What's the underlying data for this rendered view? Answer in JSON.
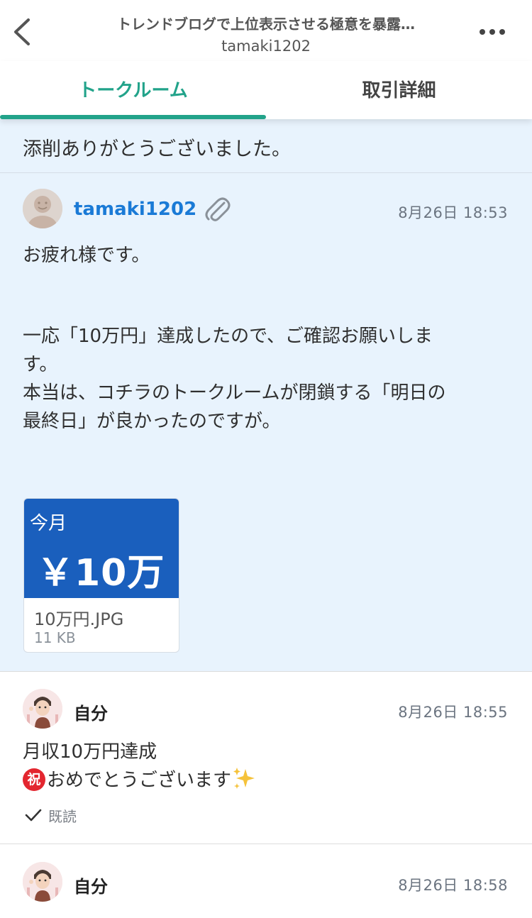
{
  "header": {
    "title": "トレンドブログで上位表示させる極意を暴露…",
    "subtitle": "tamaki1202",
    "back_icon": "chevron-left-icon",
    "more_icon": "more-horizontal-icon"
  },
  "tabs": [
    {
      "label": "トークルーム",
      "active": true
    },
    {
      "label": "取引詳細",
      "active": false
    }
  ],
  "colors": {
    "accent": "#22a38a",
    "link_blue": "#1a7ad6",
    "message_bg": "#e8f3fd",
    "thumb_blue": "#1a5fbd",
    "celebrate_red": "#e3262f"
  },
  "previous_message": {
    "text": "添削ありがとうございました。"
  },
  "messages": [
    {
      "sender": "tamaki1202",
      "time": "8月26日 18:53",
      "has_attachment_icon": true,
      "lines": [
        "お疲れ様です。",
        "一応「10万円」達成したので、ご確認お願いしま",
        "す。",
        "本当は、コチラのトークルームが閉鎖する「明日の",
        "最終日」が良かったのですが。"
      ],
      "attachment": {
        "thumb_label": "今月",
        "thumb_amount": "￥10万",
        "filename": "10万円.JPG",
        "size": "11 KB"
      }
    },
    {
      "sender": "自分",
      "time": "8月26日 18:55",
      "line1": "月収10万円達成",
      "emoji_char": "祝",
      "line2": "おめでとうございます",
      "read_label": "既読"
    },
    {
      "sender": "自分",
      "time": "8月26日 18:58"
    }
  ]
}
